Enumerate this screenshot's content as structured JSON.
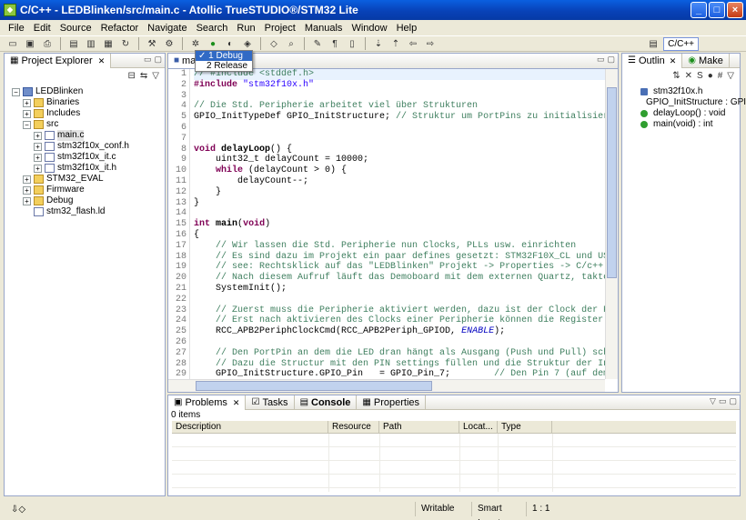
{
  "window": {
    "title": "C/C++ - LEDBlinken/src/main.c - Atollic TrueSTUDIO®/STM32 Lite"
  },
  "menu": [
    "File",
    "Edit",
    "Source",
    "Refactor",
    "Navigate",
    "Search",
    "Run",
    "Project",
    "Manuals",
    "Window",
    "Help"
  ],
  "perspective": {
    "label": "C/C++"
  },
  "explorer": {
    "title": "Project Explorer",
    "nodes": [
      {
        "label": "LEDBlinken",
        "kind": "project",
        "exp": "−"
      },
      {
        "label": "Binaries",
        "kind": "folder",
        "exp": "+"
      },
      {
        "label": "Includes",
        "kind": "folder",
        "exp": "+"
      },
      {
        "label": "src",
        "kind": "folder",
        "exp": "−"
      },
      {
        "label": "main.c",
        "kind": "file",
        "exp": "+"
      },
      {
        "label": "stm32f10x_conf.h",
        "kind": "file",
        "exp": "+"
      },
      {
        "label": "stm32f10x_it.c",
        "kind": "file",
        "exp": "+"
      },
      {
        "label": "stm32f10x_it.h",
        "kind": "file",
        "exp": "+"
      },
      {
        "label": "STM32_EVAL",
        "kind": "folder",
        "exp": "+"
      },
      {
        "label": "Firmware",
        "kind": "folder",
        "exp": "+"
      },
      {
        "label": "Debug",
        "kind": "folder",
        "exp": "+"
      },
      {
        "label": "stm32_flash.ld",
        "kind": "file",
        "exp": ""
      }
    ]
  },
  "editor": {
    "tab": "mai",
    "popup": {
      "items": [
        "1 Debug",
        "2 Release"
      ],
      "checked": "✓"
    },
    "lines": [
      {
        "n": "1",
        "html": "<span class='cm'>// #include &lt;stddef.h&gt;</span>"
      },
      {
        "n": "2",
        "html": "<span class='kw'>#include</span> <span class='str'>\"stm32f10x.h\"</span>"
      },
      {
        "n": "3",
        "html": ""
      },
      {
        "n": "4",
        "html": "<span class='cm'>// Die Std. Peripherie arbeitet viel über Strukturen</span>"
      },
      {
        "n": "5",
        "html": "GPIO_InitTypeDef GPIO_InitStructure; <span class='cm'>// Struktur um PortPins zu initialisieren</span>"
      },
      {
        "n": "6",
        "html": ""
      },
      {
        "n": "7",
        "html": ""
      },
      {
        "n": "8",
        "html": "<span class='kw'>void</span> <b>delayLoop</b>() {"
      },
      {
        "n": "9",
        "html": "    uint32_t delayCount = 10000;"
      },
      {
        "n": "10",
        "html": "    <span class='kw'>while</span> (delayCount &gt; 0) {"
      },
      {
        "n": "11",
        "html": "        delayCount--;"
      },
      {
        "n": "12",
        "html": "    }"
      },
      {
        "n": "13",
        "html": "}"
      },
      {
        "n": "14",
        "html": ""
      },
      {
        "n": "15",
        "html": "<span class='kw'>int</span> <b>main</b>(<span class='kw'>void</span>)"
      },
      {
        "n": "16",
        "html": "{"
      },
      {
        "n": "17",
        "html": "    <span class='cm'>// Wir lassen die Std. Peripherie nun Clocks, PLLs usw. einrichten</span>"
      },
      {
        "n": "18",
        "html": "    <span class='cm'>// Es sind dazu im Projekt ein paar defines gesetzt: STM32F10X_CL und USE_ST</span>"
      },
      {
        "n": "19",
        "html": "    <span class='cm'>// see: Rechtsklick auf das \"LEDBlinken\" Projekt -&gt; Properties -&gt; C/c++ Gen</span>"
      },
      {
        "n": "20",
        "html": "    <span class='cm'>// Nach diesem Aufruf läuft das Demoboard mit dem externen Quartz, taktet i</span>"
      },
      {
        "n": "21",
        "html": "    SystemInit();"
      },
      {
        "n": "22",
        "html": ""
      },
      {
        "n": "23",
        "html": "    <span class='cm'>// Zuerst muss die Peripherie aktiviert werden, dazu ist der Clock der Peri</span>"
      },
      {
        "n": "24",
        "html": "    <span class='cm'>// Erst nach aktivieren des Clocks einer Peripherie können die Register der</span>"
      },
      {
        "n": "25",
        "html": "    RCC_APB2PeriphClockCmd(RCC_APB2Periph_GPIOD, <span class='ital'>ENABLE</span>);"
      },
      {
        "n": "26",
        "html": ""
      },
      {
        "n": "27",
        "html": "    <span class='cm'>// Den PortPin an dem die LED dran hängt als Ausgang (Push und Pull) schalt</span>"
      },
      {
        "n": "28",
        "html": "    <span class='cm'>// Dazu die Structur mit den PIN settings füllen und die Struktur der Init</span>"
      },
      {
        "n": "29",
        "html": "    GPIO_InitStructure.GPIO_Pin   = GPIO_Pin_7;        <span class='cm'>// Den Pin 7 (auf dem Por</span>"
      }
    ]
  },
  "outline": {
    "tabs": [
      "Outlin",
      "Make"
    ],
    "items": [
      {
        "label": "stm32f10x.h",
        "color": "#4a6fb5",
        "square": true
      },
      {
        "label": "GPIO_InitStructure : GPIO",
        "color": "#4a6fb5",
        "square": false
      },
      {
        "label": "delayLoop() : void",
        "color": "#2f9e2f",
        "square": false
      },
      {
        "label": "main(void) : int",
        "color": "#2f9e2f",
        "square": false
      }
    ]
  },
  "bottom": {
    "tabs": [
      "Problems",
      "Tasks",
      "Console",
      "Properties"
    ],
    "count": "0 items",
    "columns": [
      "Description",
      "Resource",
      "Path",
      "Locat...",
      "Type"
    ]
  },
  "status": {
    "mode": "Writable",
    "insert": "Smart Insert",
    "pos": "1 : 1"
  }
}
